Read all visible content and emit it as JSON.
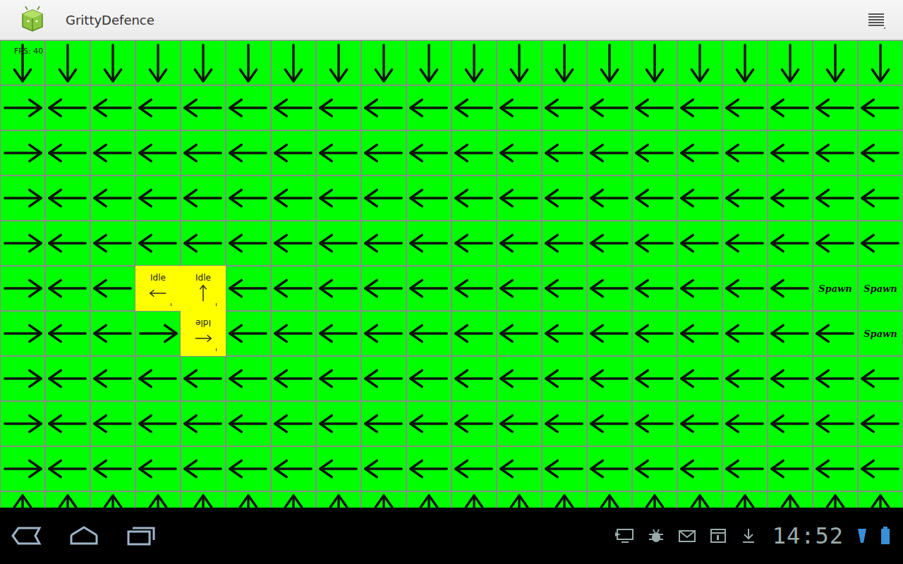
{
  "app_bar": {
    "title": "GrittyDefence"
  },
  "fps": "FPS: 40",
  "grid": {
    "spawn_label": "Spawn",
    "rows": [
      [
        "down",
        "down",
        "down",
        "down",
        "down",
        "down",
        "down",
        "down",
        "down",
        "down",
        "down",
        "down",
        "down",
        "down",
        "down",
        "down",
        "down",
        "down",
        "down",
        "down"
      ],
      [
        "right",
        "left",
        "left",
        "left",
        "left",
        "left",
        "left",
        "left",
        "left",
        "left",
        "left",
        "left",
        "left",
        "left",
        "left",
        "left",
        "left",
        "left",
        "left",
        "left"
      ],
      [
        "right",
        "left",
        "left",
        "left",
        "left",
        "left",
        "left",
        "left",
        "left",
        "left",
        "left",
        "left",
        "left",
        "left",
        "left",
        "left",
        "left",
        "left",
        "left",
        "left"
      ],
      [
        "right",
        "left",
        "left",
        "left",
        "left",
        "left",
        "left",
        "left",
        "left",
        "left",
        "left",
        "left",
        "left",
        "left",
        "left",
        "left",
        "left",
        "left",
        "left",
        "left"
      ],
      [
        "right",
        "left",
        "left",
        "left",
        "left",
        "left",
        "left",
        "left",
        "left",
        "left",
        "left",
        "left",
        "left",
        "left",
        "left",
        "left",
        "left",
        "left",
        "left",
        "left"
      ],
      [
        "right",
        "left",
        "left",
        "left",
        "left",
        "left",
        "left",
        "left",
        "left",
        "left",
        "left",
        "left",
        "left",
        "left",
        "left",
        "left",
        "left",
        "left",
        "spawn",
        "spawn"
      ],
      [
        "right",
        "left",
        "left",
        "right",
        "left",
        "left",
        "left",
        "left",
        "left",
        "left",
        "left",
        "left",
        "left",
        "left",
        "left",
        "left",
        "left",
        "left",
        "left",
        "spawn"
      ],
      [
        "right",
        "left",
        "left",
        "left",
        "left",
        "left",
        "left",
        "left",
        "left",
        "left",
        "left",
        "left",
        "left",
        "left",
        "left",
        "left",
        "left",
        "left",
        "left",
        "left"
      ],
      [
        "right",
        "left",
        "left",
        "left",
        "left",
        "left",
        "left",
        "left",
        "left",
        "left",
        "left",
        "left",
        "left",
        "left",
        "left",
        "left",
        "left",
        "left",
        "left",
        "left"
      ],
      [
        "right",
        "left",
        "left",
        "left",
        "left",
        "left",
        "left",
        "left",
        "left",
        "left",
        "left",
        "left",
        "left",
        "left",
        "left",
        "left",
        "left",
        "left",
        "left",
        "left"
      ],
      [
        "up",
        "up",
        "up",
        "up",
        "up",
        "up",
        "up",
        "up",
        "up",
        "up",
        "up",
        "up",
        "up",
        "up",
        "up",
        "up",
        "up",
        "up",
        "up",
        "up"
      ]
    ]
  },
  "units": [
    {
      "label": "Idle",
      "dir": "left",
      "row": 5,
      "col": 3,
      "flipped": false
    },
    {
      "label": "Idle",
      "dir": "up",
      "row": 5,
      "col": 4,
      "flipped": false
    },
    {
      "label": "Idle",
      "dir": "right",
      "row": 6,
      "col": 4,
      "flipped": true
    }
  ],
  "nav_bar": {
    "time": "14:52"
  }
}
